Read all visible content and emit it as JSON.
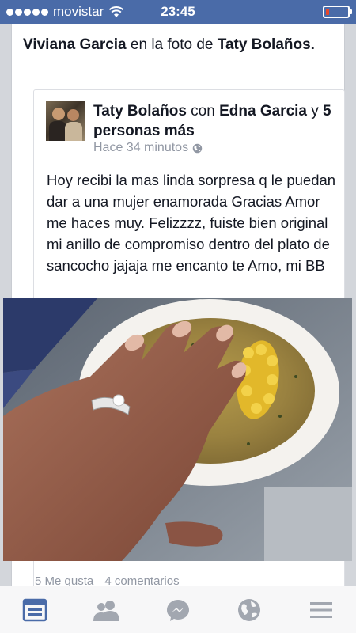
{
  "status_bar": {
    "carrier": "movistar",
    "time": "23:45",
    "battery_level": 0.15,
    "battery_color": "#e8472b"
  },
  "story": {
    "intro_name": "Viviana Garcia",
    "intro_middle": "en la foto de",
    "intro_owner": "Taty Bolaños."
  },
  "shared_post": {
    "author": "Taty Bolaños",
    "with_word": "con",
    "tagged": "Edna Garcia",
    "and_word": "y",
    "others": "5 personas más",
    "time_ago": "Hace 34 minutos",
    "privacy_icon": "globe-icon",
    "body": "Hoy recibi la mas linda sorpresa q le puedan dar a una mujer enamorada Gracias Amor me haces muy. Felizzzz, fuiste bien original mi anillo de compromiso dentro del plato de sancocho jajaja me encanto te Amo, mi BB",
    "likes": "5 Me gusta",
    "comments": "4 comentarios"
  },
  "tab_bar": {
    "tabs": [
      {
        "icon": "news-feed-icon",
        "active": true
      },
      {
        "icon": "friend-requests-icon",
        "active": false
      },
      {
        "icon": "messenger-icon",
        "active": false
      },
      {
        "icon": "notifications-globe-icon",
        "active": false
      },
      {
        "icon": "menu-icon",
        "active": false
      }
    ],
    "active_color": "#4a6ba8",
    "inactive_color": "#a2a7b0"
  }
}
